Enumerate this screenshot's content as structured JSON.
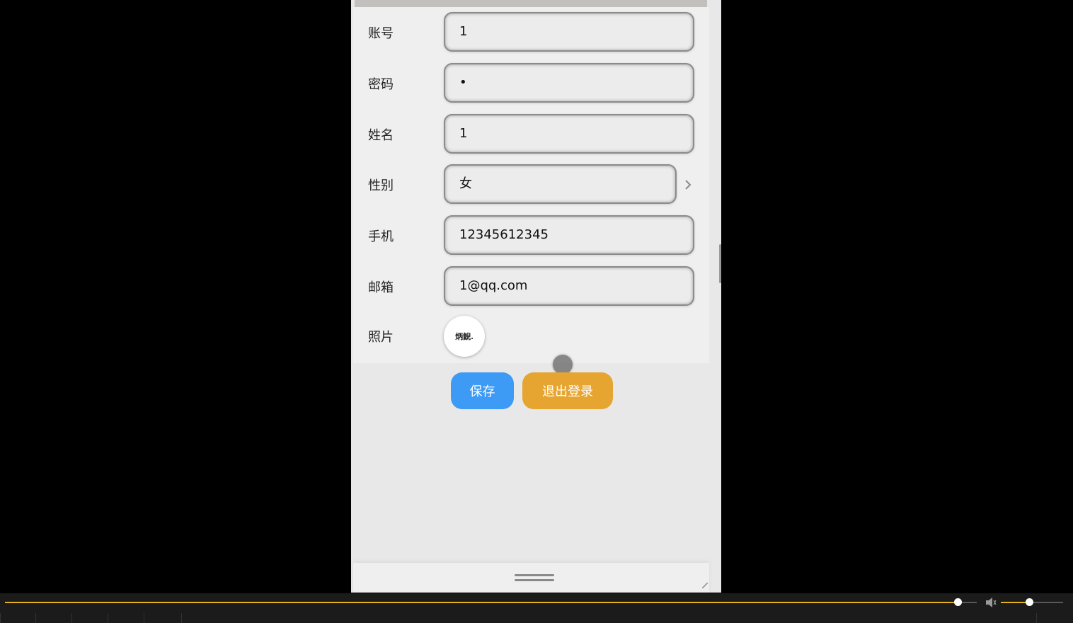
{
  "profile_form": {
    "fields": [
      {
        "label": "账号",
        "value": "1"
      },
      {
        "label": "密码",
        "value": "•"
      },
      {
        "label": "姓名",
        "value": "1"
      },
      {
        "label": "性别",
        "value": "女"
      },
      {
        "label": "手机",
        "value": "12345612345"
      },
      {
        "label": "邮箱",
        "value": "1@qq.com"
      }
    ],
    "photo_label": "照片",
    "photo_signature": "炳鯢.",
    "save_label": "保存",
    "logout_label": "退出登录"
  },
  "colors": {
    "save_button": "#3d9af5",
    "logout_button": "#e6a431",
    "player_progress": "#e4b018"
  },
  "player": {
    "playback_progress": 0.98,
    "volume_level": 0.45
  }
}
